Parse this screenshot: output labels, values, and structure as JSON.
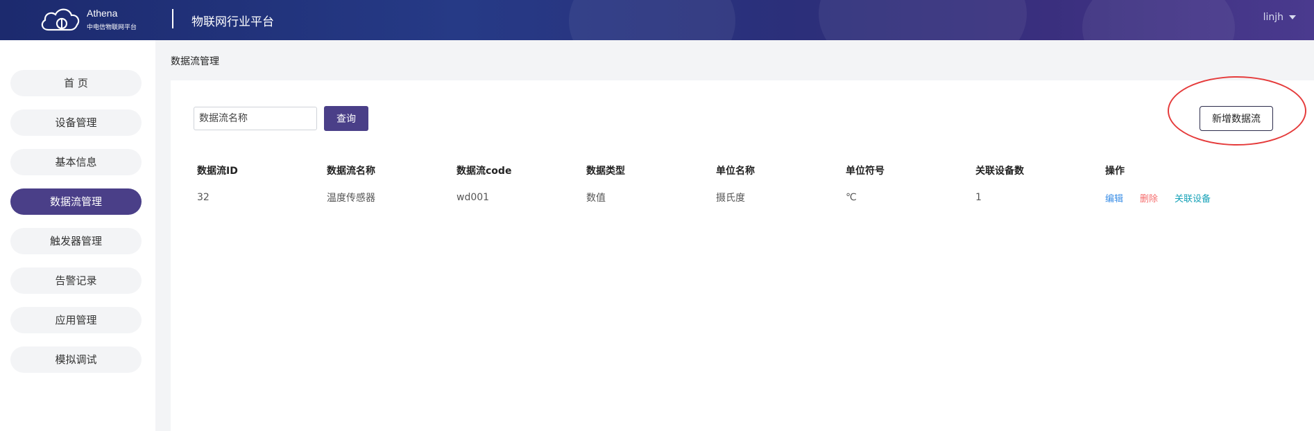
{
  "header": {
    "brand_name": "Athena",
    "brand_sub": "中电信物联网平台",
    "platform_title": "物联网行业平台",
    "user": "linjh"
  },
  "sidebar": {
    "items": [
      {
        "label": "首 页",
        "active": false
      },
      {
        "label": "设备管理",
        "active": false
      },
      {
        "label": "基本信息",
        "active": false
      },
      {
        "label": "数据流管理",
        "active": true
      },
      {
        "label": "触发器管理",
        "active": false
      },
      {
        "label": "告警记录",
        "active": false
      },
      {
        "label": "应用管理",
        "active": false
      },
      {
        "label": "模拟调试",
        "active": false
      }
    ]
  },
  "main": {
    "breadcrumb": "数据流管理",
    "search": {
      "placeholder": "数据流名称"
    },
    "query_label": "查询",
    "add_label": "新增数据流",
    "table": {
      "columns": [
        "数据流ID",
        "数据流名称",
        "数据流code",
        "数据类型",
        "单位名称",
        "单位符号",
        "关联设备数",
        "操作"
      ],
      "rows": [
        {
          "id": "32",
          "name": "温度传感器",
          "code": "wd001",
          "type": "数值",
          "unit_name": "摄氏度",
          "unit_symbol": "℃",
          "device_count": "1"
        }
      ],
      "ops": {
        "edit": "编辑",
        "delete": "删除",
        "link": "关联设备"
      }
    }
  },
  "colors": {
    "accent": "#4a3f88",
    "header_bg": "#1c2a6e",
    "highlight": "#e53b3b",
    "link_edit": "#3a8ee6",
    "link_delete": "#f56c6c",
    "link_devices": "#17a2b8"
  }
}
